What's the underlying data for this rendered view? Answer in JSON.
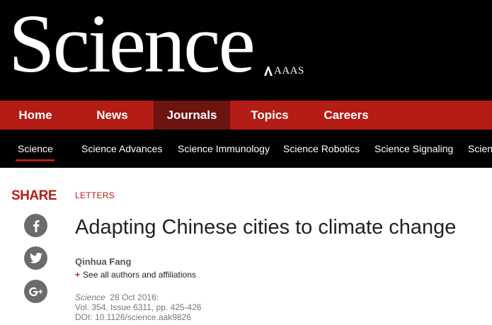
{
  "masthead": {
    "logo_text": "Science",
    "publisher": "AAAS",
    "publisher_logo_icon": "aaas-mark-icon"
  },
  "main_nav": [
    {
      "label": "Home",
      "active": false
    },
    {
      "label": "News",
      "active": false
    },
    {
      "label": "Journals",
      "active": true
    },
    {
      "label": "Topics",
      "active": false
    },
    {
      "label": "Careers",
      "active": false
    }
  ],
  "sub_nav": [
    {
      "label": "Science",
      "active": true
    },
    {
      "label": "Science Advances"
    },
    {
      "label": "Science Immunology"
    },
    {
      "label": "Science Robotics"
    },
    {
      "label": "Science Signaling"
    },
    {
      "label": "Scien"
    }
  ],
  "share": {
    "label": "SHARE",
    "buttons": [
      {
        "icon": "facebook-icon"
      },
      {
        "icon": "twitter-icon"
      },
      {
        "icon": "google-plus-icon"
      }
    ]
  },
  "article": {
    "section": "LETTERS",
    "title": "Adapting Chinese cities to climate change",
    "author": "Qinhua Fang",
    "see_all_plus": "+",
    "see_all": "See all authors and affiliations",
    "journal": "Science",
    "date": "28 Oct 2016:",
    "volume": "Vol. 354, Issue 6311, pp. 425-426",
    "doi": "DOI: 10.1126/science.aak9826"
  },
  "colors": {
    "brand_red": "#b41c16",
    "active_nav": "#6c1410",
    "masthead_bg": "#000000",
    "icon_grey": "#6b6b6b"
  }
}
